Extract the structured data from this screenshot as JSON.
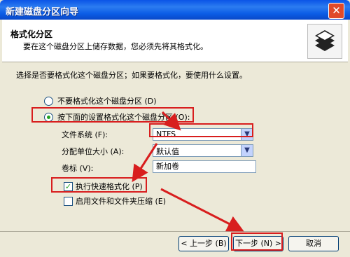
{
  "window": {
    "title": "新建磁盘分区向导"
  },
  "header": {
    "title": "格式化分区",
    "subtitle": "要在这个磁盘分区上储存数据，您必须先将其格式化。"
  },
  "body": {
    "prompt": "选择是否要格式化这个磁盘分区；如果要格式化，要使用什么设置。",
    "option_no_format": "不要格式化这个磁盘分区 (D)",
    "option_format": "按下面的设置格式化这个磁盘分区 (O):",
    "file_system_label": "文件系统 (F):",
    "file_system_value": "NTFS",
    "allocation_label": "分配单位大小 (A):",
    "allocation_value": "默认值",
    "volume_label": "卷标 (V):",
    "volume_value": "新加卷",
    "quick_format_label": "执行快速格式化 (P)",
    "compression_label": "启用文件和文件夹压缩 (E)"
  },
  "buttons": {
    "back": "< 上一步 (B)",
    "next": "下一步 (N) >",
    "cancel": "取消"
  },
  "icons": {
    "close": "close-icon",
    "wizard": "disk-stack-icon"
  },
  "colors": {
    "title_bar": "#0a54e6",
    "highlight": "#d81e1e",
    "face": "#ece9d8"
  }
}
